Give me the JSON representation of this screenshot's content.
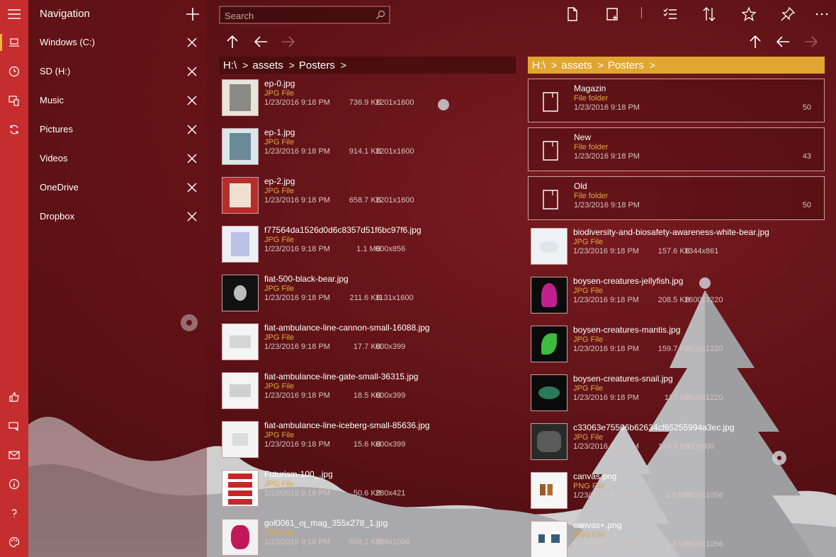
{
  "nav": {
    "title": "Navigation",
    "items": [
      {
        "label": "Windows (C:)"
      },
      {
        "label": "SD (H:)"
      },
      {
        "label": "Music"
      },
      {
        "label": "Pictures"
      },
      {
        "label": "Videos"
      },
      {
        "label": "OneDrive"
      },
      {
        "label": "Dropbox"
      }
    ]
  },
  "search": {
    "placeholder": "Search",
    "value": ""
  },
  "toolbar": {
    "icons": [
      "new-file-icon",
      "new-folder-icon",
      "select-icon",
      "sort-icon",
      "favorite-icon",
      "pin-icon",
      "more-icon"
    ]
  },
  "left_pane": {
    "breadcrumb": [
      "H:\\",
      "assets",
      "Posters"
    ],
    "files": [
      {
        "name": "ep-0.jpg",
        "type": "JPG File",
        "date": "1/23/2016 9:18 PM",
        "size": "736.9 KB",
        "dims": "1201x1600"
      },
      {
        "name": "ep-1.jpg",
        "type": "JPG File",
        "date": "1/23/2016 9:18 PM",
        "size": "914.1 KB",
        "dims": "1201x1600"
      },
      {
        "name": "ep-2.jpg",
        "type": "JPG File",
        "date": "1/23/2016 9:18 PM",
        "size": "658.7 KB",
        "dims": "1201x1600"
      },
      {
        "name": "f77564da1526d0d6c8357d51f6bc97f6.jpg",
        "type": "JPG File",
        "date": "1/23/2016 9:18 PM",
        "size": "1.1 MB",
        "dims": "600x856"
      },
      {
        "name": "fiat-500-black-bear.jpg",
        "type": "JPG File",
        "date": "1/23/2016 9:18 PM",
        "size": "211.6 KB",
        "dims": "1131x1600"
      },
      {
        "name": "fiat-ambulance-line-cannon-small-16088.jpg",
        "type": "JPG File",
        "date": "1/23/2016 9:18 PM",
        "size": "17.7 KB",
        "dims": "600x399"
      },
      {
        "name": "fiat-ambulance-line-gate-small-36315.jpg",
        "type": "JPG File",
        "date": "1/23/2016 9:18 PM",
        "size": "18.5 KB",
        "dims": "600x399"
      },
      {
        "name": "fiat-ambulance-line-iceberg-small-85636.jpg",
        "type": "JPG File",
        "date": "1/23/2016 9:18 PM",
        "size": "15.6 KB",
        "dims": "600x399"
      },
      {
        "name": "Futurism-100_.jpg",
        "type": "JPG File",
        "date": "1/23/2016 9:18 PM",
        "size": "50.6 KB",
        "dims": "280x421"
      },
      {
        "name": "gol0061_oj_mag_355x278_1.jpg",
        "type": "JPG File",
        "date": "1/23/2016 9:18 PM",
        "size": "559.2 KB",
        "dims": "788x1006"
      }
    ]
  },
  "right_pane": {
    "breadcrumb": [
      "H:\\",
      "assets",
      "Posters"
    ],
    "folders": [
      {
        "name": "Magazin",
        "type": "File folder",
        "date": "1/23/2016 9:18 PM",
        "count": "50"
      },
      {
        "name": "New",
        "type": "File folder",
        "date": "1/23/2016 9:18 PM",
        "count": "43"
      },
      {
        "name": "Old",
        "type": "File folder",
        "date": "1/23/2016 9:18 PM",
        "count": "50"
      }
    ],
    "files": [
      {
        "name": "biodiversity-and-biosafety-awareness-white-bear.jpg",
        "type": "JPG File",
        "date": "1/23/2016 9:18 PM",
        "size": "157.6 KB",
        "dims": "1344x861"
      },
      {
        "name": "boysen-creatures-jellyfish.jpg",
        "type": "JPG File",
        "date": "1/23/2016 9:18 PM",
        "size": "208.5 KB",
        "dims": "1600x1220"
      },
      {
        "name": "boysen-creatures-mantis.jpg",
        "type": "JPG File",
        "date": "1/23/2016 9:18 PM",
        "size": "159.7 KB",
        "dims": "1600x1220"
      },
      {
        "name": "boysen-creatures-snail.jpg",
        "type": "JPG File",
        "date": "1/23/2016 9:18 PM",
        "size": "137 KB",
        "dims": "1600x1220"
      },
      {
        "name": "c33063e75506b62634cf65255994a3ec.jpg",
        "type": "JPG File",
        "date": "1/23/2016 9:18 PM",
        "size": "144.8 KB",
        "dims": "600x600"
      },
      {
        "name": "canvas.png",
        "type": "PNG File",
        "date": "1/23/2016 9:18 PM",
        "size": "1.5 MB",
        "dims": "1920x1056"
      },
      {
        "name": "canvas+.png",
        "type": "PNG File",
        "date": "1/23/2016 9:18 PM",
        "size": "1.4 MB",
        "dims": "1920x1056"
      }
    ]
  },
  "colors": {
    "rail": "#c52d2f",
    "accent": "#e0a631",
    "file_type": "#e3a640",
    "background": "#5e1216"
  }
}
